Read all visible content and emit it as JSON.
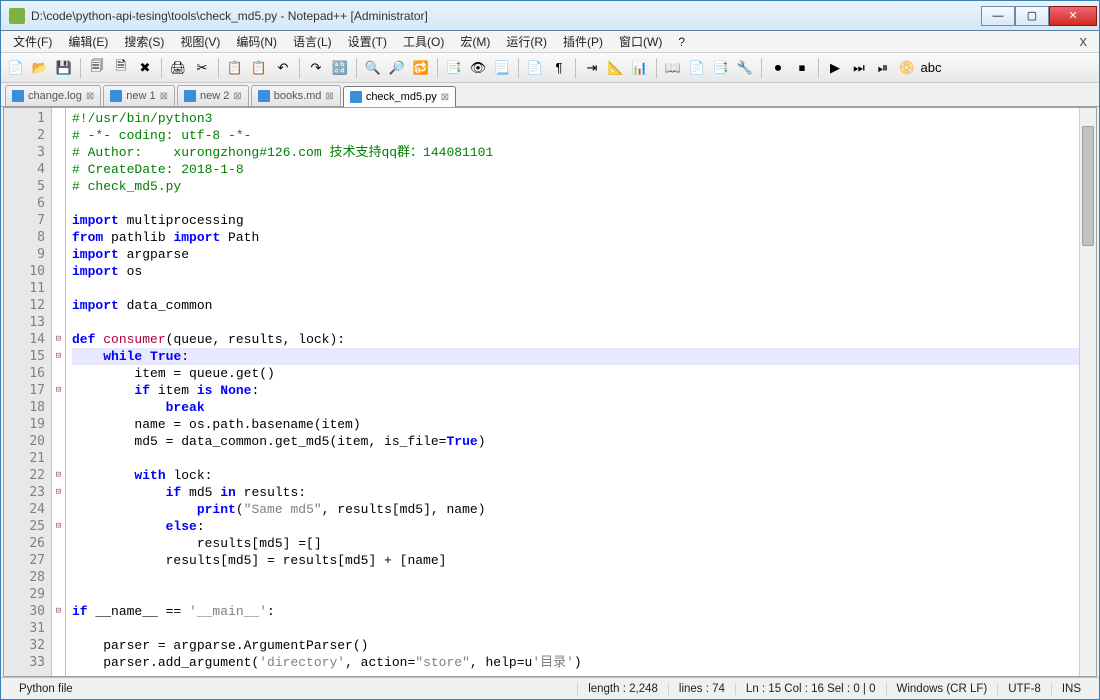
{
  "window": {
    "title": "D:\\code\\python-api-tesing\\tools\\check_md5.py - Notepad++ [Administrator]"
  },
  "menu": [
    "文件(F)",
    "编辑(E)",
    "搜索(S)",
    "视图(V)",
    "编码(N)",
    "语言(L)",
    "设置(T)",
    "工具(O)",
    "宏(M)",
    "运行(R)",
    "插件(P)",
    "窗口(W)",
    "?"
  ],
  "tabs": [
    {
      "label": "change.log",
      "active": false
    },
    {
      "label": "new 1",
      "active": false
    },
    {
      "label": "new 2",
      "active": false
    },
    {
      "label": "books.md",
      "active": false
    },
    {
      "label": "check_md5.py",
      "active": true
    }
  ],
  "code_lines": [
    {
      "n": 1,
      "seg": [
        [
          "com",
          "#!/usr/bin/python3"
        ]
      ]
    },
    {
      "n": 2,
      "seg": [
        [
          "com",
          "# -*- coding: utf-8 -*-"
        ]
      ]
    },
    {
      "n": 3,
      "seg": [
        [
          "com",
          "# Author:    xurongzhong#126.com 技术支持qq群：144081101"
        ]
      ]
    },
    {
      "n": 4,
      "seg": [
        [
          "com",
          "# CreateDate: 2018-1-8"
        ]
      ]
    },
    {
      "n": 5,
      "seg": [
        [
          "com",
          "# check_md5.py"
        ]
      ]
    },
    {
      "n": 6,
      "seg": []
    },
    {
      "n": 7,
      "seg": [
        [
          "kw",
          "import"
        ],
        [
          "",
          " multiprocessing"
        ]
      ]
    },
    {
      "n": 8,
      "seg": [
        [
          "kw",
          "from"
        ],
        [
          "",
          " pathlib "
        ],
        [
          "kw",
          "import"
        ],
        [
          "",
          " Path"
        ]
      ]
    },
    {
      "n": 9,
      "seg": [
        [
          "kw",
          "import"
        ],
        [
          "",
          " argparse"
        ]
      ]
    },
    {
      "n": 10,
      "seg": [
        [
          "kw",
          "import"
        ],
        [
          "",
          " os"
        ]
      ]
    },
    {
      "n": 11,
      "seg": []
    },
    {
      "n": 12,
      "seg": [
        [
          "kw",
          "import"
        ],
        [
          "",
          " data_common"
        ]
      ]
    },
    {
      "n": 13,
      "seg": []
    },
    {
      "n": 14,
      "fold": "⊟",
      "seg": [
        [
          "kw",
          "def"
        ],
        [
          "",
          " "
        ],
        [
          "def",
          "consumer"
        ],
        [
          "",
          "(queue, results, lock):"
        ]
      ]
    },
    {
      "n": 15,
      "fold": "⊟",
      "cur": true,
      "seg": [
        [
          "",
          "    "
        ],
        [
          "kw",
          "while"
        ],
        [
          "",
          " "
        ],
        [
          "kw",
          "True"
        ],
        [
          "",
          ":"
        ]
      ]
    },
    {
      "n": 16,
      "seg": [
        [
          "",
          "        item = queue.get()"
        ]
      ]
    },
    {
      "n": 17,
      "fold": "⊟",
      "seg": [
        [
          "",
          "        "
        ],
        [
          "kw",
          "if"
        ],
        [
          "",
          " item "
        ],
        [
          "kw",
          "is"
        ],
        [
          "",
          " "
        ],
        [
          "kw",
          "None"
        ],
        [
          "",
          ":"
        ]
      ]
    },
    {
      "n": 18,
      "seg": [
        [
          "",
          "            "
        ],
        [
          "kw",
          "break"
        ]
      ]
    },
    {
      "n": 19,
      "seg": [
        [
          "",
          "        name = os.path.basename(item)"
        ]
      ]
    },
    {
      "n": 20,
      "seg": [
        [
          "",
          "        md5 = data_common.get_md5(item, is_file="
        ],
        [
          "kw",
          "True"
        ],
        [
          "",
          ")"
        ]
      ]
    },
    {
      "n": 21,
      "seg": []
    },
    {
      "n": 22,
      "fold": "⊟",
      "seg": [
        [
          "",
          "        "
        ],
        [
          "kw",
          "with"
        ],
        [
          "",
          " lock:"
        ]
      ]
    },
    {
      "n": 23,
      "fold": "⊟",
      "seg": [
        [
          "",
          "            "
        ],
        [
          "kw",
          "if"
        ],
        [
          "",
          " md5 "
        ],
        [
          "kw",
          "in"
        ],
        [
          "",
          " results:"
        ]
      ]
    },
    {
      "n": 24,
      "seg": [
        [
          "",
          "                "
        ],
        [
          "kw",
          "print"
        ],
        [
          "",
          "("
        ],
        [
          "str",
          "\"Same md5\""
        ],
        [
          "",
          ", results[md5], name)"
        ]
      ]
    },
    {
      "n": 25,
      "fold": "⊟",
      "seg": [
        [
          "",
          "            "
        ],
        [
          "kw",
          "else"
        ],
        [
          "",
          ":"
        ]
      ]
    },
    {
      "n": 26,
      "seg": [
        [
          "",
          "                results[md5] =[]"
        ]
      ]
    },
    {
      "n": 27,
      "seg": [
        [
          "",
          "            results[md5] = results[md5] + [name]"
        ]
      ]
    },
    {
      "n": 28,
      "seg": []
    },
    {
      "n": 29,
      "seg": []
    },
    {
      "n": 30,
      "fold": "⊟",
      "seg": [
        [
          "kw",
          "if"
        ],
        [
          "",
          " __name__ == "
        ],
        [
          "str",
          "'__main__'"
        ],
        [
          "",
          ":"
        ]
      ]
    },
    {
      "n": 31,
      "seg": []
    },
    {
      "n": 32,
      "seg": [
        [
          "",
          "    parser = argparse.ArgumentParser()"
        ]
      ]
    },
    {
      "n": 33,
      "seg": [
        [
          "",
          "    parser.add_argument("
        ],
        [
          "str",
          "'directory'"
        ],
        [
          "",
          ", action="
        ],
        [
          "str",
          "\"store\""
        ],
        [
          "",
          ", help=u"
        ],
        [
          "str",
          "'目录'"
        ],
        [
          "",
          ")"
        ]
      ]
    }
  ],
  "status": {
    "filetype": "Python file",
    "length": "length : 2,248",
    "lines": "lines : 74",
    "pos": "Ln : 15    Col : 16    Sel : 0 | 0",
    "eol": "Windows (CR LF)",
    "enc": "UTF-8",
    "ins": "INS"
  },
  "toolbar_icons": [
    "📄",
    "📂",
    "💾",
    "🗐",
    "🗎",
    "✖",
    "🖨",
    "✂",
    "📋",
    "📋",
    "↶",
    "↷",
    "🔡",
    "🔍",
    "🔎",
    "🔂",
    "📑",
    "👁",
    "📃",
    "📄",
    "¶",
    "⇥",
    "📐",
    "📊",
    "📖",
    "📄",
    "📑",
    "🔧",
    "⏺",
    "⏹",
    "▶",
    "⏭",
    "⏯",
    "📀",
    "abc"
  ]
}
